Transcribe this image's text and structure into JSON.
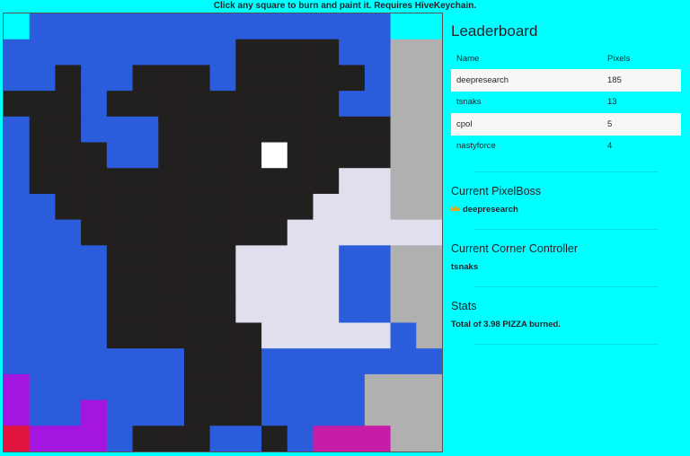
{
  "banner": "Click any square to burn and paint it. Requires HiveKeychain.",
  "palette": {
    "c": "#00ffff",
    "b": "#2b5cdb",
    "k": "#221f1f",
    "w": "#ffffff",
    "l": "#e0dfee",
    "g": "#b0b0b0",
    "p": "#a515e0",
    "r": "#e0143c",
    "m": "#c71ba8",
    "o": "#ff4d0d"
  },
  "board_rows": [
    "cbbbbbbbbbbbbbbc",
    "bbbbbbbbbkkkkbbg",
    "bbkbbkkkbkkkkkbg",
    "kkkbkkkkkkkkkbbg",
    "bkkbbbkkkkkkkkkg",
    "bkkkbbkkkkwkkkkg",
    "bkkkkkkkkkkkkllg",
    "bbkkkkkkkkkklllg",
    "bbbkkkkkkkklllll",
    "bbbbkkkkkllllbbg",
    "bbbbkkkkkllllbbg",
    "bbbbkkkkkllllbbg",
    "bbbbkkkkkklllllbg",
    "bbbbbbbkkkbbbbbb",
    "pbbbbbbkkkbbbbgg",
    "pbbpbbbkkkbbbbgg",
    "rpppbkkkbbkbmmmg"
  ],
  "leaderboard": {
    "title": "Leaderboard",
    "columns": [
      "Name",
      "Pixels"
    ],
    "rows": [
      {
        "name": "deepresearch",
        "pixels": "185"
      },
      {
        "name": "tsnaks",
        "pixels": "13"
      },
      {
        "name": "cpol",
        "pixels": "5"
      },
      {
        "name": "nastyforce",
        "pixels": "4"
      }
    ]
  },
  "pixelboss": {
    "title": "Current PixelBoss",
    "icon": "crown-icon",
    "name": "deepresearch"
  },
  "corner": {
    "title": "Current Corner Controller",
    "name": "tsnaks"
  },
  "stats": {
    "title": "Stats",
    "text": "Total of 3.98 PIZZA burned."
  }
}
